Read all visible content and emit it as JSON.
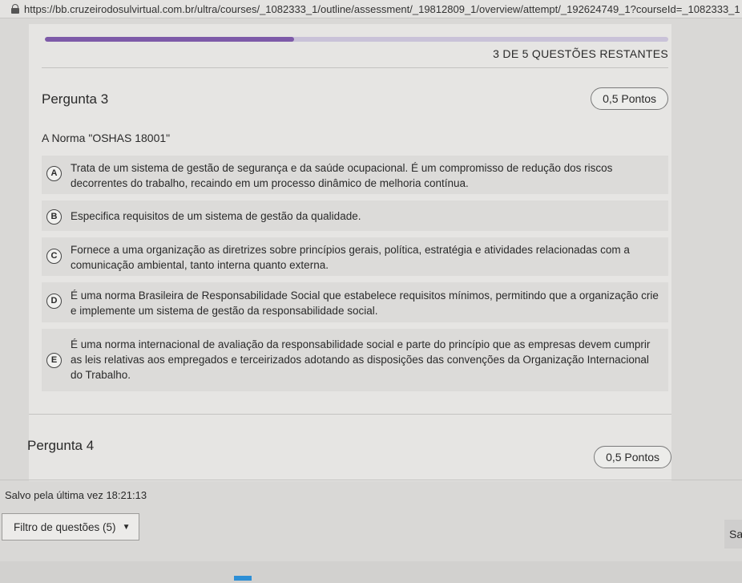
{
  "browser": {
    "url": "https://bb.cruzeirodosulvirtual.com.br/ultra/courses/_1082333_1/outline/assessment/_19812809_1/overview/attempt/_192624749_1?courseId=_1082333_1"
  },
  "progress": {
    "fraction": 0.4,
    "remaining_label": "3 DE 5 QUESTÕES RESTANTES"
  },
  "question3": {
    "title": "Pergunta 3",
    "points": "0,5 Pontos",
    "prompt": "A Norma \"OSHAS 18001\"",
    "options": [
      {
        "letter": "A",
        "text": "Trata de um sistema de gestão de segurança e da saúde ocupacional. É um compromisso de redução dos riscos decorrentes do trabalho, recaindo em um processo dinâmico de melhoria contínua."
      },
      {
        "letter": "B",
        "text": "Especifica requisitos de um sistema de gestão da qualidade."
      },
      {
        "letter": "C",
        "text": "Fornece a uma organização as diretrizes sobre princípios gerais, política, estratégia e atividades relacionadas com a comunicação ambiental, tanto interna quanto externa."
      },
      {
        "letter": "D",
        "text": "É uma norma Brasileira de Responsabilidade Social que estabelece requisitos mínimos, permitindo que a organização crie e implemente um sistema de gestão da responsabilidade social."
      },
      {
        "letter": "E",
        "text": "É uma norma internacional de avaliação da responsabilidade social e parte do princípio que as empresas devem cumprir as leis relativas aos empregados e terceirizados adotando as disposições das convenções da Organização Internacional do Trabalho."
      }
    ]
  },
  "question4": {
    "title": "Pergunta 4",
    "points": "0,5 Pontos"
  },
  "footer": {
    "saved_label": "Salvo pela última vez 18:21:13",
    "filter_label": "Filtro de questões (5)",
    "save_button_label": "Sa"
  }
}
